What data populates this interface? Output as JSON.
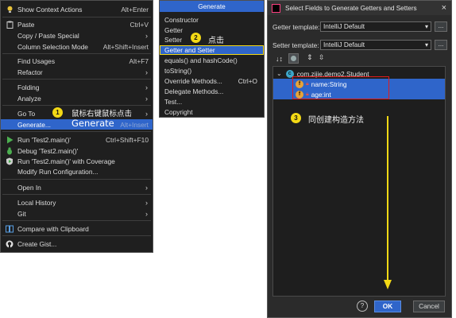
{
  "context_menu": {
    "items": [
      {
        "label": "Show Context Actions",
        "shortcut": "Alt+Enter",
        "icon": "bulb-icon"
      },
      {
        "label": "Paste",
        "shortcut": "Ctrl+V",
        "icon": "paste-icon"
      },
      {
        "label": "Copy / Paste Special",
        "arrow": "›"
      },
      {
        "label": "Column Selection Mode",
        "shortcut": "Alt+Shift+Insert"
      },
      {
        "label": "Find Usages",
        "shortcut": "Alt+F7"
      },
      {
        "label": "Refactor",
        "arrow": "›"
      },
      {
        "label": "Folding",
        "arrow": "›"
      },
      {
        "label": "Analyze",
        "arrow": "›"
      },
      {
        "label": "Go To",
        "arrow": "›"
      },
      {
        "label": "Generate...",
        "shortcut": "Alt+Insert"
      },
      {
        "label": "Run 'Test2.main()'",
        "shortcut": "Ctrl+Shift+F10",
        "icon": "run-icon"
      },
      {
        "label": "Debug 'Test2.main()'",
        "icon": "debug-icon"
      },
      {
        "label": "Run 'Test2.main()' with Coverage",
        "icon": "coverage-icon"
      },
      {
        "label": "Modify Run Configuration..."
      },
      {
        "label": "Open In",
        "arrow": "›"
      },
      {
        "label": "Local History",
        "arrow": "›"
      },
      {
        "label": "Git",
        "arrow": "›"
      },
      {
        "label": "Compare with Clipboard",
        "icon": "compare-icon"
      },
      {
        "label": "Create Gist...",
        "icon": "github-icon"
      }
    ]
  },
  "generate_menu": {
    "title": "Generate",
    "items": [
      "Constructor",
      "Getter",
      "Setter",
      "Getter and Setter",
      "equals() and hashCode()",
      "toString()",
      "Override Methods...",
      "Delegate Methods...",
      "Test...",
      "Copyright"
    ],
    "override_shortcut": "Ctrl+O"
  },
  "annotations": {
    "step1_number": "1",
    "step1_text": "鼠标右键鼠标点击",
    "generate_overlay": "Generate",
    "step2_number": "2",
    "step2_text": "点击",
    "step3_number": "3",
    "step3_text": "同创建构造方法"
  },
  "dialog": {
    "title": "Select Fields to Generate Getters and Setters",
    "getter_label": "Getter template:",
    "getter_value": "IntelliJ Default",
    "setter_label": "Setter template:",
    "setter_value": "IntelliJ Default",
    "ellipsis": "...",
    "tree_root": "com.zijie.demo2.Student",
    "fields": [
      "name:String",
      "age:int"
    ],
    "field_badge": "f",
    "help": "?",
    "ok": "OK",
    "cancel": "Cancel"
  },
  "colors": {
    "selection": "#2f65ca",
    "annotation_yellow": "#f3d915",
    "highlight_red": "#e01c1c",
    "menu_bg": "#1f1f1f"
  }
}
